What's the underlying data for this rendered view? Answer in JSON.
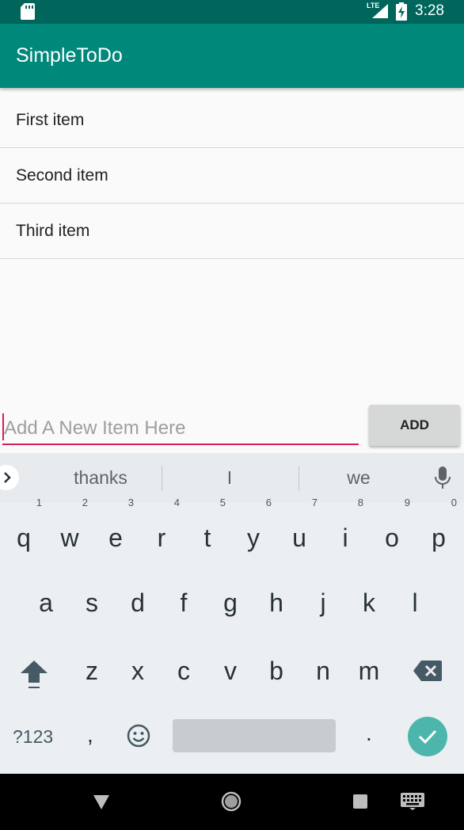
{
  "status_bar": {
    "time": "3:28",
    "network": "LTE"
  },
  "app_bar": {
    "title": "SimpleToDo"
  },
  "items": [
    "First item",
    "Second item",
    "Third item"
  ],
  "new_item": {
    "placeholder": "Add A New Item Here",
    "value": ""
  },
  "add_button": {
    "label": "ADD"
  },
  "keyboard": {
    "suggestions": [
      "thanks",
      "I",
      "we"
    ],
    "row1": [
      {
        "key": "q",
        "hint": "1"
      },
      {
        "key": "w",
        "hint": "2"
      },
      {
        "key": "e",
        "hint": "3"
      },
      {
        "key": "r",
        "hint": "4"
      },
      {
        "key": "t",
        "hint": "5"
      },
      {
        "key": "y",
        "hint": "6"
      },
      {
        "key": "u",
        "hint": "7"
      },
      {
        "key": "i",
        "hint": "8"
      },
      {
        "key": "o",
        "hint": "9"
      },
      {
        "key": "p",
        "hint": "0"
      }
    ],
    "row2": [
      "a",
      "s",
      "d",
      "f",
      "g",
      "h",
      "j",
      "k",
      "l"
    ],
    "row3": [
      "z",
      "x",
      "c",
      "v",
      "b",
      "n",
      "m"
    ],
    "symbols_label": "?123",
    "comma": ",",
    "period": "."
  },
  "colors": {
    "status_bar": "#00665c",
    "app_bar": "#00897b",
    "accent": "#d81b60",
    "enter_key": "#4db6ac",
    "keyboard_bg": "#eceff1"
  },
  "icons": [
    "sd-card-icon",
    "signal-icon",
    "battery-charging-icon",
    "chevron-right-icon",
    "mic-icon",
    "shift-icon",
    "backspace-icon",
    "emoji-icon",
    "check-icon",
    "nav-back-icon",
    "nav-home-icon",
    "nav-recents-icon",
    "keyboard-icon"
  ]
}
